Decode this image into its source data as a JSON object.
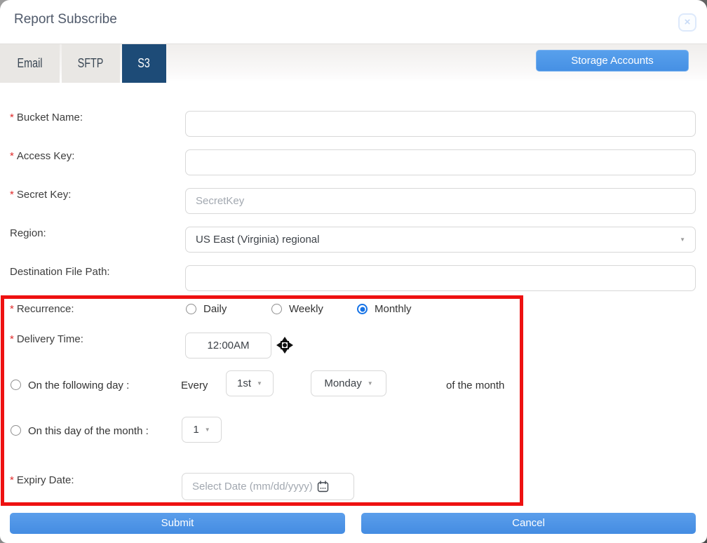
{
  "header": {
    "title": "Report Subscribe",
    "close_glyph": "×"
  },
  "tabs": [
    {
      "label": "Email",
      "active": false
    },
    {
      "label": "SFTP",
      "active": false
    },
    {
      "label": "S3",
      "active": true
    }
  ],
  "toolbar": {
    "storage_accounts_label": "Storage Accounts"
  },
  "marks": {
    "required": "*",
    "caret": "▼"
  },
  "form": {
    "bucket_name": {
      "label": "Bucket Name:",
      "required": true,
      "value": "",
      "placeholder": ""
    },
    "access_key": {
      "label": "Access Key:",
      "required": true,
      "value": "",
      "placeholder": ""
    },
    "secret_key": {
      "label": "Secret Key:",
      "required": true,
      "value": "",
      "placeholder": "SecretKey"
    },
    "region": {
      "label": "Region:",
      "required": false,
      "value": "US East (Virginia) regional"
    },
    "destination_file_path": {
      "label": "Destination File Path:",
      "required": false,
      "value": "",
      "placeholder": ""
    },
    "recurrence": {
      "label": "Recurrence:",
      "required": true,
      "options": [
        "Daily",
        "Weekly",
        "Monthly"
      ],
      "selected": "Monthly"
    },
    "delivery_time": {
      "label": "Delivery Time:",
      "required": true,
      "value": "12:00AM"
    },
    "on_following_day": {
      "label": "On the following day :",
      "selected": false,
      "every_label": "Every",
      "ordinal_value": "1st",
      "weekday_value": "Monday",
      "suffix_label": "of the month"
    },
    "on_day_of_month": {
      "label": "On this day of the month :",
      "selected": false,
      "day_value": "1"
    },
    "expiry_date": {
      "label": "Expiry Date:",
      "required": true,
      "placeholder": "Select Date (mm/dd/yyyy)"
    }
  },
  "footer": {
    "submit_label": "Submit",
    "cancel_label": "Cancel"
  },
  "colors": {
    "accent_blue": "#4b93e6",
    "brand_navy": "#1d4b77",
    "highlight_red": "#ee1111",
    "required_red": "#e02b2b",
    "radio_selected_blue": "#1673e6",
    "tab_gray": "#e9e7e4"
  }
}
